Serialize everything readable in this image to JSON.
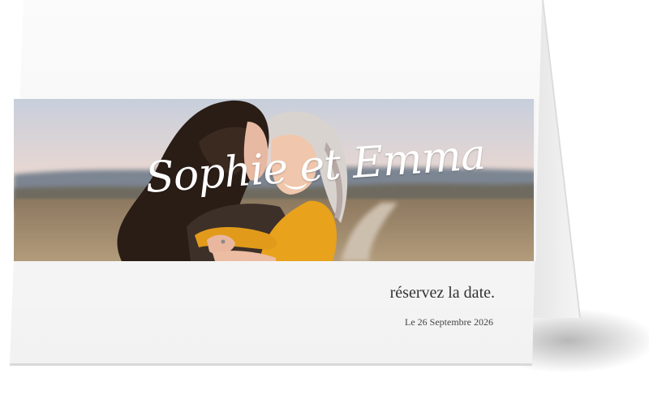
{
  "card": {
    "names": "Sophie et Emma",
    "tagline": "réservez la date.",
    "date": "Le 26 Septembre 2026"
  },
  "colors": {
    "card_paper": "#f7f7f7",
    "card_back": "#eeeeee",
    "names_text": "#ffffff",
    "tagline_text": "#333333",
    "date_text": "#444444",
    "sweater": "#e8a21c"
  }
}
